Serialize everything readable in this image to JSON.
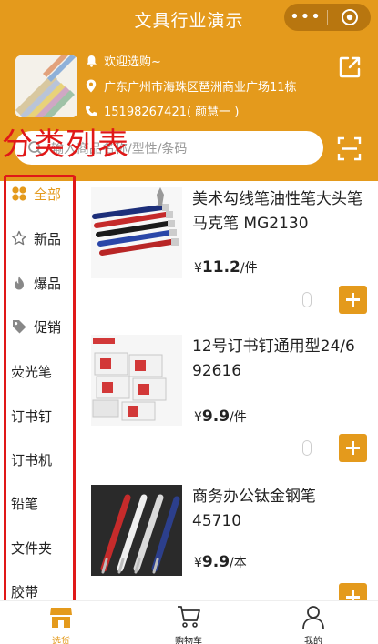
{
  "header": {
    "title": "文具行业演示",
    "capsule_more": "•••",
    "greeting": "欢迎选购~",
    "address": "广东广州市海珠区琶洲商业广场11栋",
    "phone": "15198267421( 颜慧一 )"
  },
  "search": {
    "placeholder": "输入商品名称/型性/条码"
  },
  "overlay_label": "分类列表",
  "sidebar": {
    "items": [
      {
        "label": "全部",
        "icon": "grid-icon"
      },
      {
        "label": "新品",
        "icon": "star-icon"
      },
      {
        "label": "爆品",
        "icon": "fire-icon"
      },
      {
        "label": "促销",
        "icon": "tag-icon"
      },
      {
        "label": "荧光笔"
      },
      {
        "label": "订书钉"
      },
      {
        "label": "订书机"
      },
      {
        "label": "铅笔"
      },
      {
        "label": "文件夹"
      },
      {
        "label": "胶带"
      }
    ]
  },
  "products": [
    {
      "name": "美术勾线笔油性笔大头笔马克笔 MG2130",
      "price_symbol": "¥",
      "price": "11.2",
      "unit": "/件",
      "qty": "0"
    },
    {
      "name": "12号订书钉通用型24/6 92616",
      "price_symbol": "¥",
      "price": "9.9",
      "unit": "/件",
      "qty": "0"
    },
    {
      "name": "商务办公钛金钢笔 45710",
      "price_symbol": "¥",
      "price": "9.9",
      "unit": "/本",
      "qty": ""
    }
  ],
  "tabbar": {
    "tabs": [
      {
        "label": "选货"
      },
      {
        "label": "购物车"
      },
      {
        "label": "我的"
      }
    ]
  },
  "colors": {
    "brand": "#e49a1c",
    "annotation": "#e01818"
  }
}
